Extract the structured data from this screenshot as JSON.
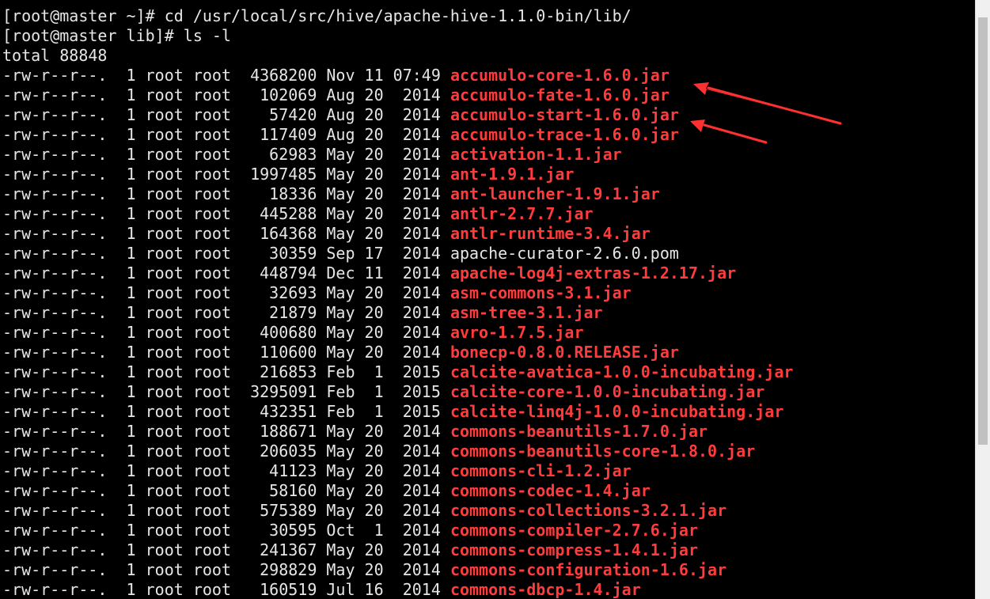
{
  "colors": {
    "background": "#000000",
    "text": "#e6e6e6",
    "archive": "#ff3b3b",
    "annotation": "#ff3030"
  },
  "lines": [
    {
      "text": "[root@master ~]# cd /usr/local/src/hive/apache-hive-1.1.0-bin/lib/"
    },
    {
      "text": "[root@master lib]# ls -l"
    },
    {
      "text": "total 88848"
    },
    {
      "prefix": "-rw-r--r--.  1 root root  4368200 Nov 11 07:49 ",
      "name": "accumulo-core-1.6.0.jar",
      "archive": true
    },
    {
      "prefix": "-rw-r--r--.  1 root root   102069 Aug 20  2014 ",
      "name": "accumulo-fate-1.6.0.jar",
      "archive": true
    },
    {
      "prefix": "-rw-r--r--.  1 root root    57420 Aug 20  2014 ",
      "name": "accumulo-start-1.6.0.jar",
      "archive": true
    },
    {
      "prefix": "-rw-r--r--.  1 root root   117409 Aug 20  2014 ",
      "name": "accumulo-trace-1.6.0.jar",
      "archive": true
    },
    {
      "prefix": "-rw-r--r--.  1 root root    62983 May 20  2014 ",
      "name": "activation-1.1.jar",
      "archive": true
    },
    {
      "prefix": "-rw-r--r--.  1 root root  1997485 May 20  2014 ",
      "name": "ant-1.9.1.jar",
      "archive": true
    },
    {
      "prefix": "-rw-r--r--.  1 root root    18336 May 20  2014 ",
      "name": "ant-launcher-1.9.1.jar",
      "archive": true
    },
    {
      "prefix": "-rw-r--r--.  1 root root   445288 May 20  2014 ",
      "name": "antlr-2.7.7.jar",
      "archive": true
    },
    {
      "prefix": "-rw-r--r--.  1 root root   164368 May 20  2014 ",
      "name": "antlr-runtime-3.4.jar",
      "archive": true
    },
    {
      "prefix": "-rw-r--r--.  1 root root    30359 Sep 17  2014 ",
      "name": "apache-curator-2.6.0.pom",
      "archive": false
    },
    {
      "prefix": "-rw-r--r--.  1 root root   448794 Dec 11  2014 ",
      "name": "apache-log4j-extras-1.2.17.jar",
      "archive": true
    },
    {
      "prefix": "-rw-r--r--.  1 root root    32693 May 20  2014 ",
      "name": "asm-commons-3.1.jar",
      "archive": true
    },
    {
      "prefix": "-rw-r--r--.  1 root root    21879 May 20  2014 ",
      "name": "asm-tree-3.1.jar",
      "archive": true
    },
    {
      "prefix": "-rw-r--r--.  1 root root   400680 May 20  2014 ",
      "name": "avro-1.7.5.jar",
      "archive": true
    },
    {
      "prefix": "-rw-r--r--.  1 root root   110600 May 20  2014 ",
      "name": "bonecp-0.8.0.RELEASE.jar",
      "archive": true
    },
    {
      "prefix": "-rw-r--r--.  1 root root   216853 Feb  1  2015 ",
      "name": "calcite-avatica-1.0.0-incubating.jar",
      "archive": true
    },
    {
      "prefix": "-rw-r--r--.  1 root root  3295091 Feb  1  2015 ",
      "name": "calcite-core-1.0.0-incubating.jar",
      "archive": true
    },
    {
      "prefix": "-rw-r--r--.  1 root root   432351 Feb  1  2015 ",
      "name": "calcite-linq4j-1.0.0-incubating.jar",
      "archive": true
    },
    {
      "prefix": "-rw-r--r--.  1 root root   188671 May 20  2014 ",
      "name": "commons-beanutils-1.7.0.jar",
      "archive": true
    },
    {
      "prefix": "-rw-r--r--.  1 root root   206035 May 20  2014 ",
      "name": "commons-beanutils-core-1.8.0.jar",
      "archive": true
    },
    {
      "prefix": "-rw-r--r--.  1 root root    41123 May 20  2014 ",
      "name": "commons-cli-1.2.jar",
      "archive": true
    },
    {
      "prefix": "-rw-r--r--.  1 root root    58160 May 20  2014 ",
      "name": "commons-codec-1.4.jar",
      "archive": true
    },
    {
      "prefix": "-rw-r--r--.  1 root root   575389 May 20  2014 ",
      "name": "commons-collections-3.2.1.jar",
      "archive": true
    },
    {
      "prefix": "-rw-r--r--.  1 root root    30595 Oct  1  2014 ",
      "name": "commons-compiler-2.7.6.jar",
      "archive": true
    },
    {
      "prefix": "-rw-r--r--.  1 root root   241367 May 20  2014 ",
      "name": "commons-compress-1.4.1.jar",
      "archive": true
    },
    {
      "prefix": "-rw-r--r--.  1 root root   298829 May 20  2014 ",
      "name": "commons-configuration-1.6.jar",
      "archive": true
    },
    {
      "prefix": "-rw-r--r--.  1 root root   160519 Jul 16  2014 ",
      "name": "commons-dbcp-1.4.jar",
      "archive": true
    }
  ],
  "annotations": [
    {
      "points_to": "accumulo-core-1.6.0.jar",
      "icon": "red-arrow-icon"
    },
    {
      "points_to": "accumulo-trace-1.6.0.jar",
      "icon": "red-arrow-icon"
    }
  ]
}
